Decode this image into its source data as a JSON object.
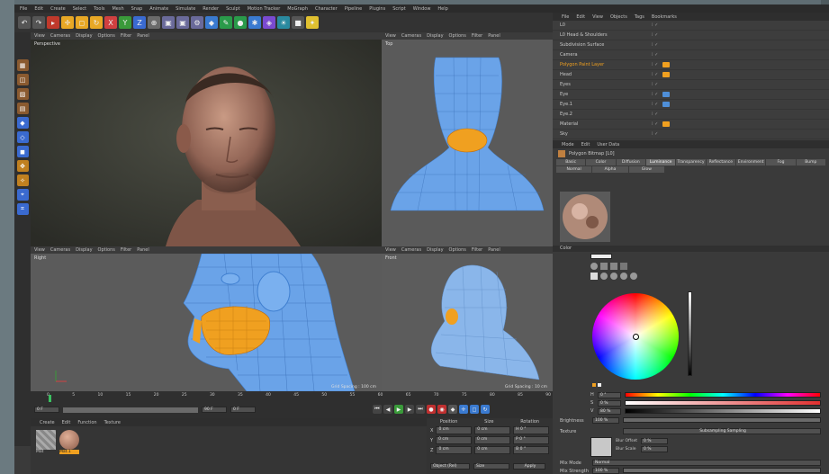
{
  "menus": [
    "File",
    "Edit",
    "Create",
    "Select",
    "Tools",
    "Mesh",
    "Snap",
    "Animate",
    "Simulate",
    "Render",
    "Sculpt",
    "Motion Tracker",
    "MoGraph",
    "Character",
    "Pipeline",
    "Plugins",
    "Script",
    "Window",
    "Help"
  ],
  "viewport_menus": [
    "View",
    "Cameras",
    "Display",
    "Options",
    "Filter",
    "Panel"
  ],
  "viewports": {
    "top_left_label": "Perspective",
    "top_right_label": "Top",
    "bottom_left_label": "Right",
    "bottom_right_label": "Front",
    "bottom_left_footer": "Grid Spacing : 100 cm",
    "bottom_right_footer": "Grid Spacing : 10 cm"
  },
  "object_manager": {
    "menus": [
      "File",
      "Edit",
      "View",
      "Objects",
      "Tags",
      "Bookmarks"
    ],
    "rows": [
      {
        "name": "L0",
        "highlight": false,
        "tag": ""
      },
      {
        "name": "L0 Head & Shoulders",
        "highlight": false,
        "tag": ""
      },
      {
        "name": "Subdivision Surface",
        "highlight": false,
        "tag": ""
      },
      {
        "name": "Camera",
        "highlight": false,
        "tag": ""
      },
      {
        "name": "Polygon Paint Layer",
        "highlight": true,
        "tag": "orange"
      },
      {
        "name": "Head",
        "highlight": false,
        "tag": "orange"
      },
      {
        "name": "Eyes",
        "highlight": false,
        "tag": ""
      },
      {
        "name": "Eye",
        "highlight": false,
        "tag": "blue"
      },
      {
        "name": "Eye.1",
        "highlight": false,
        "tag": "blue"
      },
      {
        "name": "Eye.2",
        "highlight": false,
        "tag": ""
      },
      {
        "name": "Material",
        "highlight": false,
        "tag": "orange"
      },
      {
        "name": "Sky",
        "highlight": false,
        "tag": ""
      }
    ]
  },
  "attributes": {
    "menus": [
      "Mode",
      "Edit",
      "User Data"
    ],
    "title": "Polygon Bitmap [L0]",
    "tabs_row1": [
      "Basic",
      "Color",
      "Diffusion",
      "Luminance",
      "Transparency",
      "Reflectance",
      "Environment",
      "Fog",
      "Bump"
    ],
    "tabs_row2": [
      "Normal",
      "Alpha",
      "Glow"
    ],
    "section": "Color",
    "channels": [
      {
        "label": "H",
        "value": "0 °"
      },
      {
        "label": "S",
        "value": "0 %"
      },
      {
        "label": "V",
        "value": "80 %"
      }
    ],
    "brightness_label": "Brightness",
    "brightness_value": "100 %",
    "texture_label": "Texture",
    "sampling": "Subsampling Sampling",
    "blur_offset_label": "Blur Offset",
    "blur_offset": "0 %",
    "blur_scale_label": "Blur Scale",
    "blur_scale": "0 %",
    "mix_label": "Mix Mode",
    "mix_mode": "Normal",
    "mix_strength_label": "Mix Strength",
    "mix_strength": "100 %"
  },
  "timeline": {
    "ticks": [
      "0",
      "5",
      "10",
      "15",
      "20",
      "25",
      "30",
      "35",
      "40",
      "45",
      "50",
      "55",
      "60",
      "65",
      "70",
      "75",
      "80",
      "85",
      "90"
    ],
    "start_frame": "0 F",
    "end_frame": "90 F",
    "current_frame": "0 F"
  },
  "material_manager": {
    "menus": [
      "Create",
      "Edit",
      "Function",
      "Texture"
    ],
    "materials": [
      "Mat",
      "Mat.1"
    ]
  },
  "coordinates": {
    "headers": [
      "Position",
      "Size",
      "Rotation"
    ],
    "rows": [
      {
        "axis": "X",
        "pos": "0 cm",
        "size": "0 cm",
        "rot": "H 0 °"
      },
      {
        "axis": "Y",
        "pos": "0 cm",
        "size": "0 cm",
        "rot": "P 0 °"
      },
      {
        "axis": "Z",
        "pos": "0 cm",
        "size": "0 cm",
        "rot": "B 0 °"
      }
    ],
    "mode": "Object (Rel)",
    "size_mode": "Size",
    "apply": "Apply"
  },
  "colors": {
    "accent": "#f0a020",
    "mesh": "#4f8fd8",
    "selection": "#f0a020"
  }
}
